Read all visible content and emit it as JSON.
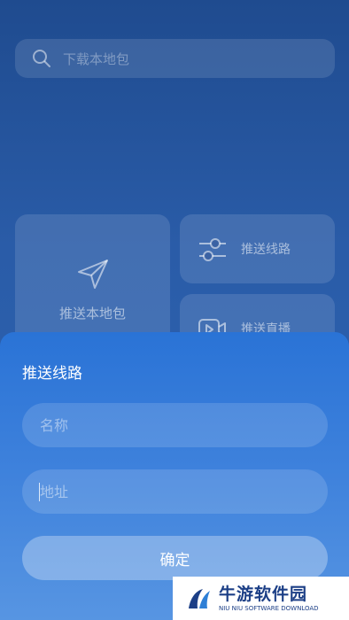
{
  "search": {
    "placeholder": "下载本地包"
  },
  "cards": {
    "push_local": {
      "label": "推送本地包",
      "icon": "send-icon"
    },
    "push_line": {
      "label": "推送线路",
      "icon": "sliders-icon"
    },
    "push_live": {
      "label": "推送直播",
      "icon": "video-icon"
    }
  },
  "sheet": {
    "title": "推送线路",
    "name_placeholder": "名称",
    "address_placeholder": "地址",
    "confirm_label": "确定"
  },
  "watermark": {
    "title": "牛游软件园",
    "subtitle": "NIU NIU SOFTWARE DOWNLOAD"
  },
  "colors": {
    "background": "#1f4b8f",
    "sheet": "#2a73d6",
    "brand": "#1c3f86"
  }
}
